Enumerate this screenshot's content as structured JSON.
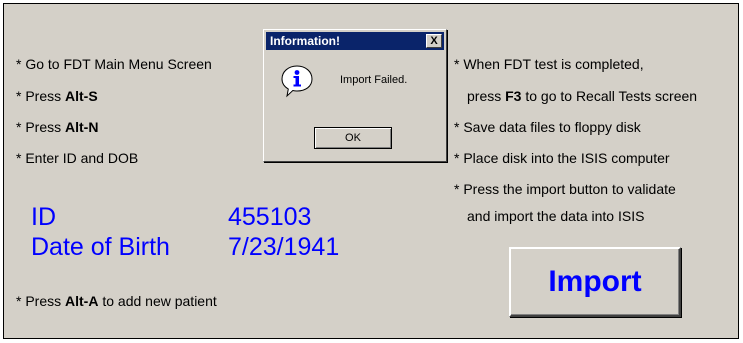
{
  "left_instructions": [
    {
      "before": "* Go to FDT Main Menu Screen",
      "key": "",
      "after": ""
    },
    {
      "before": "* Press ",
      "key": "Alt-S",
      "after": ""
    },
    {
      "before": "* Press ",
      "key": "Alt-N",
      "after": ""
    },
    {
      "before": "* Enter ID and DOB",
      "key": "",
      "after": ""
    }
  ],
  "right_instructions": [
    {
      "before": "* When FDT test is completed,",
      "key": "",
      "after": ""
    },
    {
      "before": "press ",
      "key": "F3",
      "after": " to go to Recall Tests screen"
    },
    {
      "before": "* Save data files to floppy disk",
      "key": "",
      "after": ""
    },
    {
      "before": "* Place disk into the ISIS computer",
      "key": "",
      "after": ""
    },
    {
      "before": "* Press the import button to validate",
      "key": "",
      "after": ""
    },
    {
      "before": "and import the data into ISIS",
      "key": "",
      "after": ""
    }
  ],
  "patient": {
    "id_label": "ID",
    "id_value": "455103",
    "dob_label": "Date of Birth",
    "dob_value": "7/23/1941"
  },
  "add_patient_note": {
    "before": "* Press ",
    "key": "Alt-A",
    "after": " to add new patient"
  },
  "import_button_label": "Import",
  "dialog": {
    "title": "Information!",
    "close_glyph": "X",
    "message": "Import Failed.",
    "ok_label": "OK",
    "icon": "information-icon"
  },
  "colors": {
    "panel_bg": "#d4d0c8",
    "accent_blue": "#0000ff",
    "title_bar": "#0a246a"
  }
}
